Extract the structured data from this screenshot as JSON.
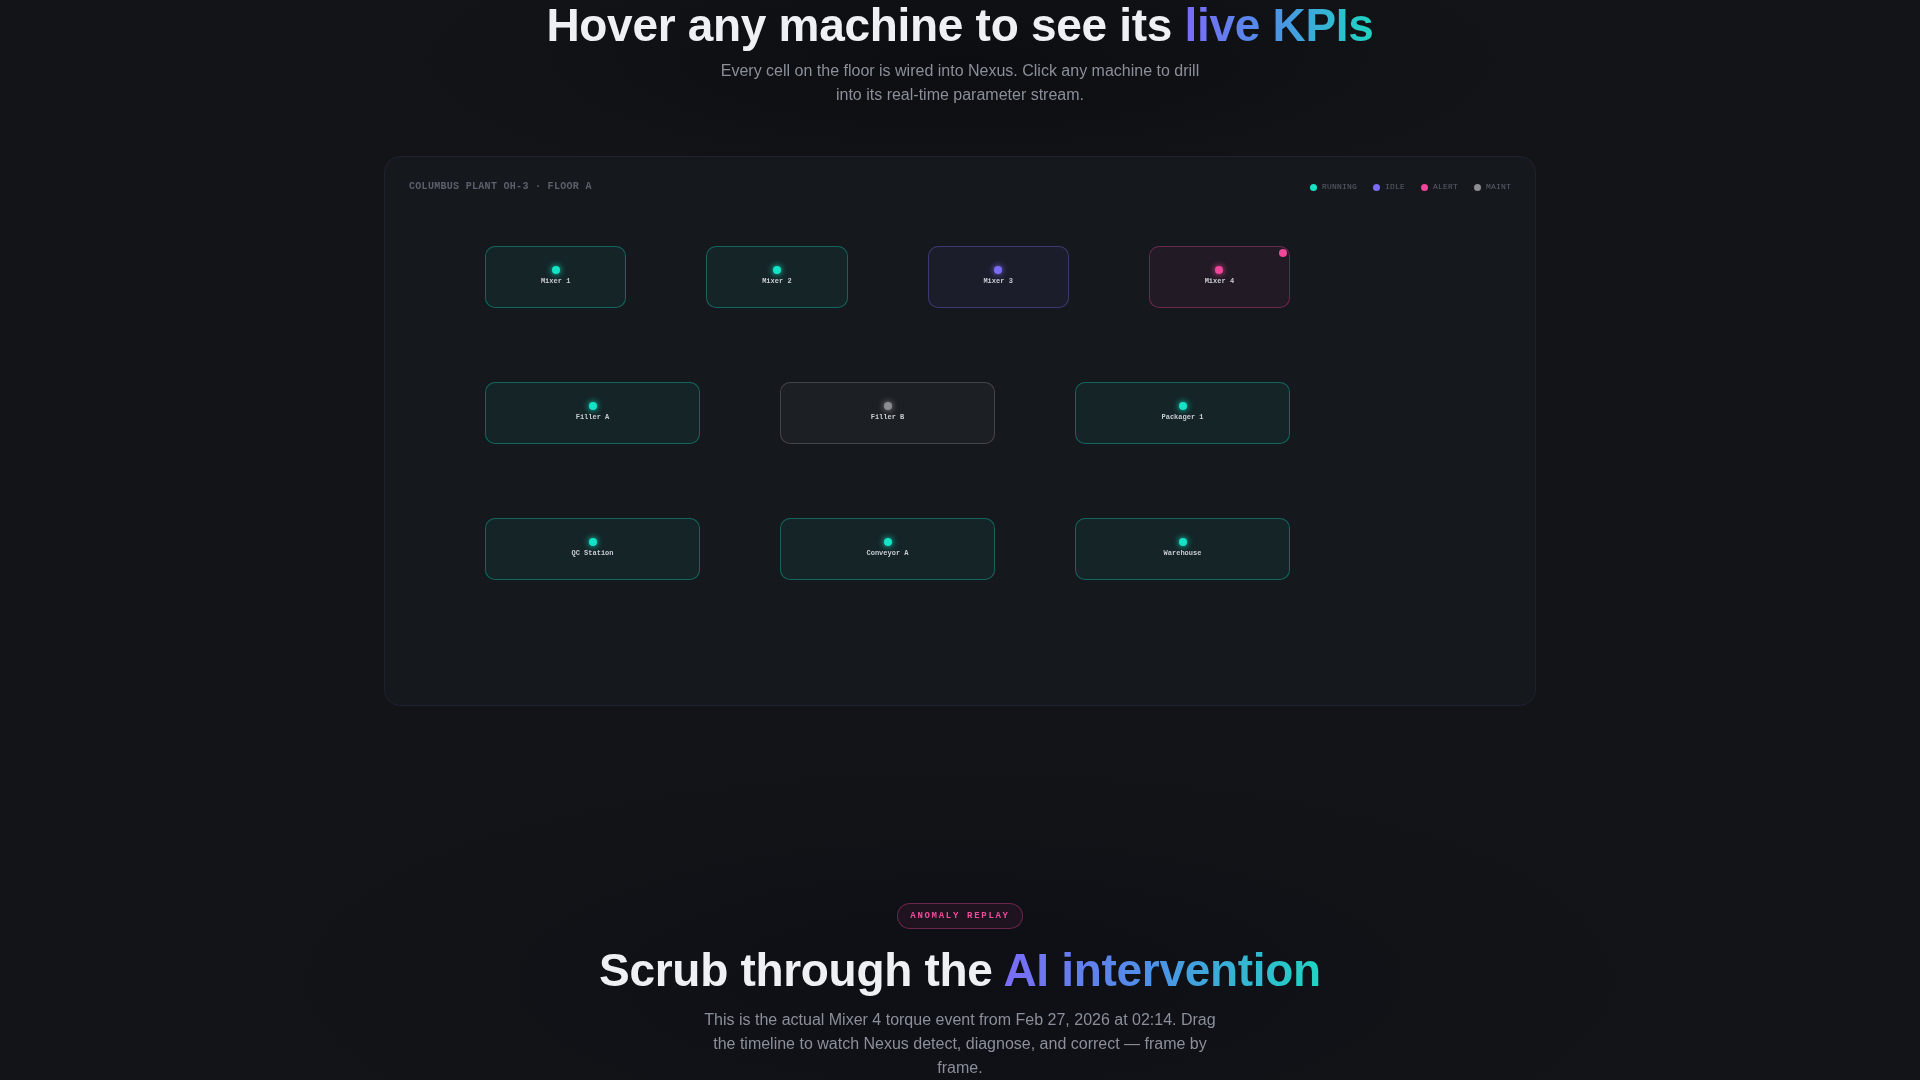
{
  "intro": {
    "heading": {
      "text": "Hover any machine to see its",
      "highlight": "live KPIs"
    },
    "description": "Every cell on the floor is wired into Nexus. Click any machine to drill into its real-time parameter stream."
  },
  "floor_map": {
    "title": "COLUMBUS PLANT OH-3 · FLOOR A",
    "legend": [
      {
        "label": "RUNNING",
        "color": "#14e3c5"
      },
      {
        "label": "IDLE",
        "color": "#7b6cf6"
      },
      {
        "label": "ALERT",
        "color": "#f0479a"
      },
      {
        "label": "MAINT",
        "color": "#8b8d92"
      }
    ],
    "rows": [
      {
        "machines": [
          {
            "label": "Mixer 1",
            "color": "#14e3c5",
            "flagged": false
          },
          {
            "label": "Mixer 2",
            "color": "#14e3c5",
            "flagged": false
          },
          {
            "label": "Mixer 3",
            "color": "#7b6cf6",
            "flagged": false
          },
          {
            "label": "Mixer 4",
            "color": "#f0479a",
            "flagged": true
          }
        ]
      },
      {
        "machines": [
          {
            "label": "Filler A",
            "color": "#14e3c5",
            "flagged": false
          },
          {
            "label": "Filler B",
            "color": "#8b8d92",
            "flagged": false
          },
          {
            "label": "Packager 1",
            "color": "#14e3c5",
            "flagged": false
          }
        ]
      },
      {
        "machines": [
          {
            "label": "QC Station",
            "color": "#14e3c5",
            "flagged": false
          },
          {
            "label": "Conveyor A",
            "color": "#14e3c5",
            "flagged": false
          },
          {
            "label": "Warehouse",
            "color": "#14e3c5",
            "flagged": false
          }
        ]
      }
    ]
  },
  "replay": {
    "badge": "ANOMALY REPLAY",
    "heading": {
      "text": "Scrub through the",
      "highlight": "AI intervention"
    },
    "description": "This is the actual Mixer 4 torque event from Feb 27, 2026 at 02:14. Drag the timeline to watch Nexus detect, diagnose, and correct — frame by frame."
  }
}
